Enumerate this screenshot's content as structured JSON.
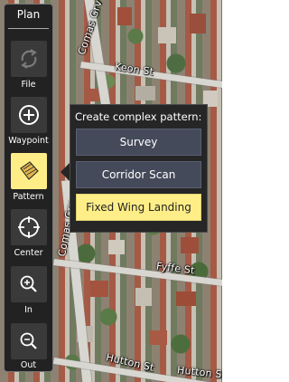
{
  "map": {
    "streets": [
      "Comas Grv",
      "Keon St",
      "Comas Grv",
      "Fyffe St",
      "Hutton St",
      "Hutton St"
    ]
  },
  "toolbar": {
    "title": "Plan",
    "items": [
      {
        "label": "File",
        "icon": "sync-icon",
        "active": false
      },
      {
        "label": "Waypoint",
        "icon": "plus-circle-icon",
        "active": false
      },
      {
        "label": "Pattern",
        "icon": "pattern-icon",
        "active": true
      },
      {
        "label": "Center",
        "icon": "crosshair-icon",
        "active": false
      },
      {
        "label": "In",
        "icon": "zoom-in-icon",
        "active": false
      },
      {
        "label": "Out",
        "icon": "zoom-out-icon",
        "active": false
      }
    ]
  },
  "popup": {
    "title": "Create complex pattern:",
    "options": [
      {
        "label": "Survey",
        "active": false
      },
      {
        "label": "Corridor Scan",
        "active": false
      },
      {
        "label": "Fixed Wing Landing",
        "active": true
      }
    ]
  },
  "colors": {
    "active": "#ffee87",
    "panel": "#222222",
    "option": "#454a5a"
  }
}
